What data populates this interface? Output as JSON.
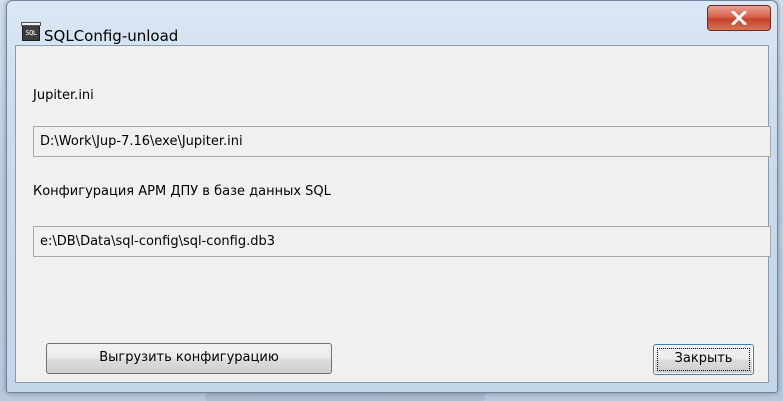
{
  "window": {
    "title": "SQLConfig-unload",
    "app_icon_text": "SQL",
    "close_icon": "close-icon",
    "close_color": "#c5432b"
  },
  "form": {
    "ini_label": "Jupiter.ini",
    "ini_path": "D:\\Work\\Jup-7.16\\exe\\Jupiter.ini",
    "db_label": "Конфигурация АРМ ДПУ в базе данных SQL",
    "db_path": "e:\\DB\\Data\\sql-config\\sql-config.db3"
  },
  "buttons": {
    "unload_label": "Выгрузить конфигурацию",
    "close_label": "Закрыть"
  }
}
